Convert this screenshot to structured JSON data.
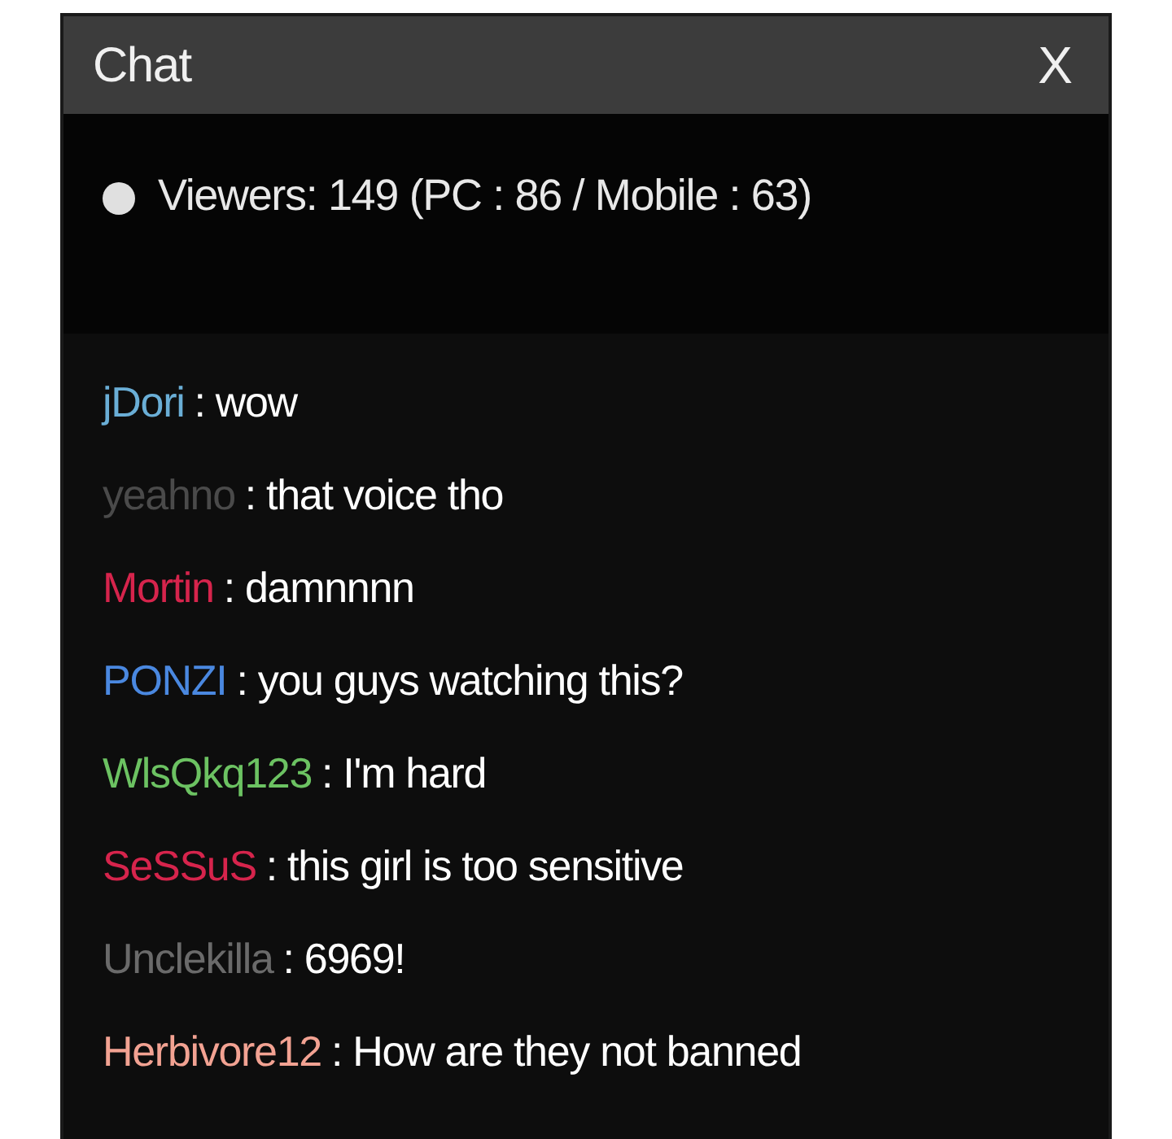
{
  "window": {
    "title": "Chat",
    "close": "X"
  },
  "viewers": "Viewers: 149 (PC : 86 / Mobile : 63)",
  "messages": [
    {
      "user": "jDori",
      "color": "#6aaed6",
      "text": ": wow"
    },
    {
      "user": "yeahno",
      "color": "#4a4a4a",
      "text": ": that voice tho"
    },
    {
      "user": "Mortin",
      "color": "#d6244c",
      "text": ": damnnnn"
    },
    {
      "user": "PONZI",
      "color": "#4a88e0",
      "text": ": you guys watching this?"
    },
    {
      "user": "WlsQkq123",
      "color": "#6cc262",
      "text": ": I'm hard"
    },
    {
      "user": "SeSSuS",
      "color": "#d6244c",
      "text": ": this girl is too sensitive"
    },
    {
      "user": "Unclekilla",
      "color": "#6a6a6a",
      "text": ": 6969!"
    },
    {
      "user": "Herbivore12",
      "color": "#f2a292",
      "text": ": How are they not banned"
    }
  ]
}
